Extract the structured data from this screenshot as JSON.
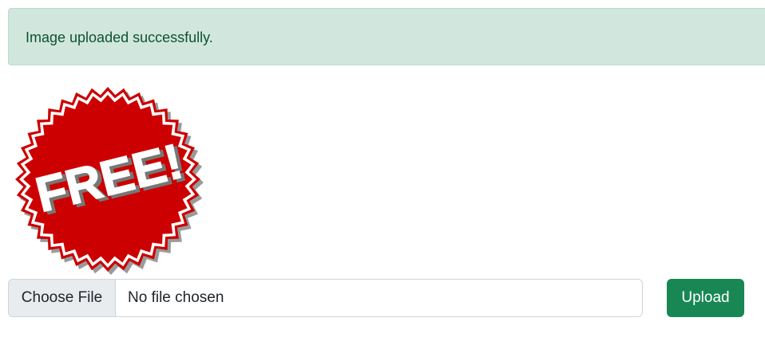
{
  "alert": {
    "message": "Image uploaded successfully."
  },
  "image": {
    "icon": "free-badge-icon",
    "badge_text": "FREE!",
    "badge_color": "#cc0000"
  },
  "upload_form": {
    "choose_label": "Choose File",
    "file_status": "No file chosen",
    "submit_label": "Upload"
  },
  "colors": {
    "alert_bg": "#d1e7dd",
    "alert_text": "#0f5132",
    "button_bg": "#198754"
  }
}
